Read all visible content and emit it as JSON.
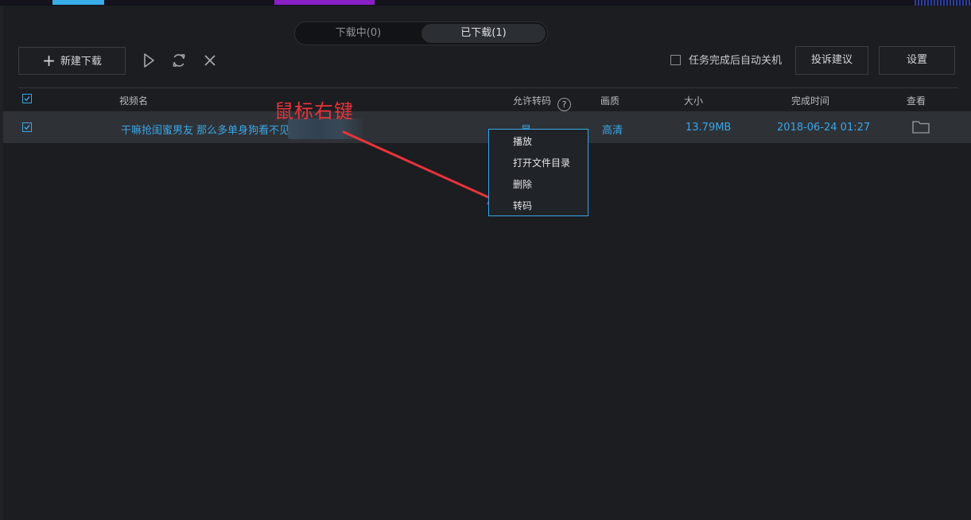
{
  "tabs": [
    {
      "label": "下载中(0)",
      "active": false
    },
    {
      "label": "已下载(1)",
      "active": true
    }
  ],
  "toolbar": {
    "new_download": "新建下载",
    "icons": [
      "play-icon",
      "refresh-icon",
      "close-icon"
    ],
    "auto_shutdown_label": "任务完成后自动关机",
    "auto_shutdown_checked": false,
    "feedback": "投诉建议",
    "settings": "设置"
  },
  "table": {
    "columns": {
      "name": "视频名",
      "transcode": "允许转码",
      "quality": "画质",
      "size": "大小",
      "finished": "完成时间",
      "view": "查看"
    },
    "rows": [
      {
        "checked": true,
        "name": "干嘛抢闺蜜男友 那么多单身狗看不见",
        "transcode": "是",
        "quality": "高清",
        "size": "13.79MB",
        "finished": "2018-06-24 01:27"
      }
    ]
  },
  "context_menu": {
    "items": [
      "播放",
      "打开文件目录",
      "删除",
      "转码"
    ]
  },
  "annotation": {
    "text": "鼠标右键",
    "color": "#e8343a"
  },
  "colors": {
    "accent": "#3aa6e6",
    "background": "#1b1d21",
    "row_selected": "#2e3237"
  }
}
